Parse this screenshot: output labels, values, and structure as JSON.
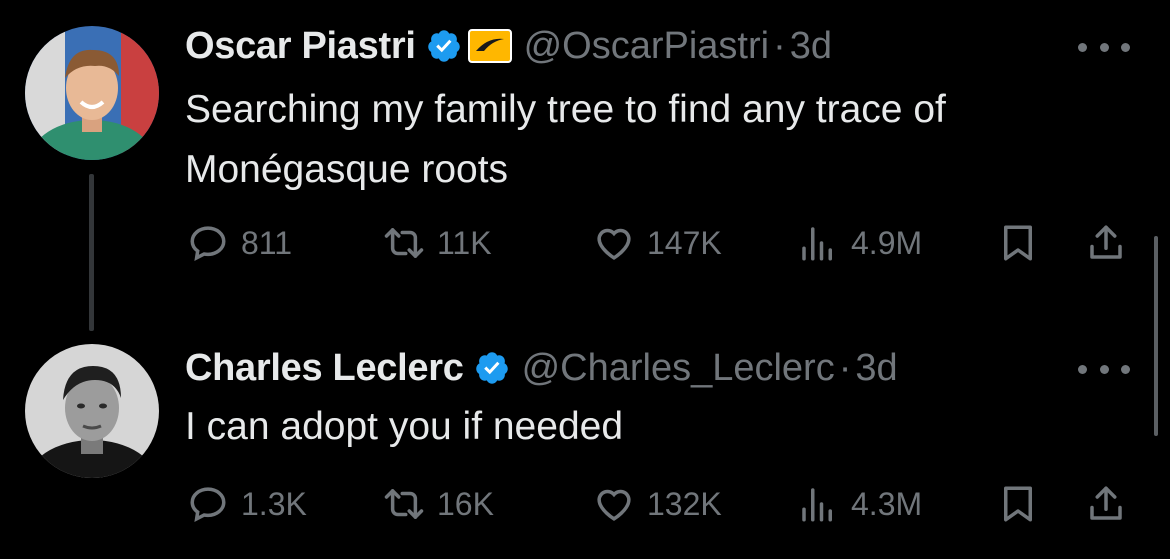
{
  "tweets": [
    {
      "author_name": "Oscar Piastri",
      "handle": "@OscarPiastri",
      "separator": "·",
      "time": "3d",
      "verified": true,
      "affiliation_badge": "mclaren-badge-icon",
      "text_lines": [
        "Searching my family tree to find any trace of",
        "Monégasque roots"
      ],
      "stats": {
        "replies": "811",
        "retweets": "11K",
        "likes": "147K",
        "views": "4.9M"
      }
    },
    {
      "author_name": "Charles Leclerc",
      "handle": "@Charles_Leclerc",
      "separator": "·",
      "time": "3d",
      "verified": true,
      "text_lines": [
        "I can adopt you if needed"
      ],
      "stats": {
        "replies": "1.3K",
        "retweets": "16K",
        "likes": "132K",
        "views": "4.3M"
      }
    }
  ],
  "icons": [
    "reply-icon",
    "retweet-icon",
    "like-icon",
    "views-icon",
    "bookmark-icon",
    "share-icon",
    "more-icon",
    "verified-icon"
  ],
  "colors": {
    "background": "#000000",
    "text": "#e7e9ea",
    "muted": "#71767b",
    "verified": "#1d9bf0",
    "badge": "#ffb700"
  }
}
